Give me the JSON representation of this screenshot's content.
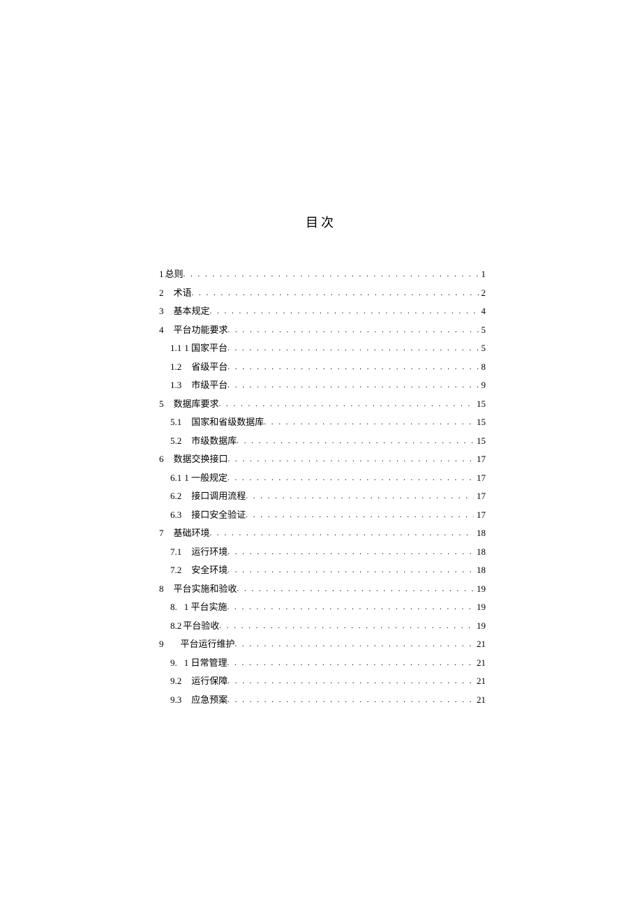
{
  "title": "目次",
  "entries": [
    {
      "num": "1",
      "gap1": 2,
      "label": "总则",
      "level": 1,
      "page": "1"
    },
    {
      "num": "2",
      "gap1": 14,
      "label": "术语",
      "level": 1,
      "page": "2"
    },
    {
      "num": "3",
      "gap1": 14,
      "label": "基本规定",
      "level": 1,
      "page": "4"
    },
    {
      "num": "4",
      "gap1": 14,
      "label": "平台功能要求",
      "level": 1,
      "page": "5"
    },
    {
      "num": "1.1",
      "gap1": 4,
      "label": "1 国家平台",
      "level": 2,
      "page": "5"
    },
    {
      "num": "1.2",
      "gap1": 14,
      "label": "省级平台",
      "level": 2,
      "page": "8"
    },
    {
      "num": "1.3",
      "gap1": 14,
      "label": "市级平台",
      "level": 2,
      "page": "9"
    },
    {
      "num": "5",
      "gap1": 14,
      "label": "数据库要求",
      "level": 1,
      "page": "15"
    },
    {
      "num": "5.1",
      "gap1": 14,
      "label": "国家和省级数据库",
      "level": 2,
      "page": "15"
    },
    {
      "num": "5.2",
      "gap1": 14,
      "label": "市级数据库",
      "level": 2,
      "page": "15"
    },
    {
      "num": "6",
      "gap1": 14,
      "label": "数据交换接口",
      "level": 1,
      "page": "17"
    },
    {
      "num": "6.1",
      "gap1": 4,
      "label": "1 一般规定",
      "level": 2,
      "page": "17"
    },
    {
      "num": "6.2",
      "gap1": 14,
      "label": "接口调用流程",
      "level": 2,
      "page": "17"
    },
    {
      "num": "6.3",
      "gap1": 14,
      "label": "接口安全验证",
      "level": 2,
      "page": "17"
    },
    {
      "num": "7",
      "gap1": 14,
      "label": "基础环境",
      "level": 1,
      "page": "18"
    },
    {
      "num": "7.1",
      "gap1": 14,
      "label": "运行环境",
      "level": 2,
      "page": "18"
    },
    {
      "num": "7.2",
      "gap1": 14,
      "label": "安全环境",
      "level": 2,
      "page": "18"
    },
    {
      "num": "8",
      "gap1": 14,
      "label": "平台实施和验收",
      "level": 1,
      "page": "19"
    },
    {
      "num": "8.",
      "gap1": 10,
      "label": "1 平台实施",
      "level": 2,
      "page": "19"
    },
    {
      "num": "8.2",
      "gap1": 2,
      "label": "平台验收",
      "level": 2,
      "page": "19"
    },
    {
      "num": "9",
      "gap1": 24,
      "label": "平台运行维护",
      "level": 1,
      "page": "21"
    },
    {
      "num": "9.",
      "gap1": 10,
      "label": "1 日常管理",
      "level": 2,
      "page": "21"
    },
    {
      "num": "9.2",
      "gap1": 14,
      "label": "运行保障",
      "level": 2,
      "page": "21"
    },
    {
      "num": "9.3",
      "gap1": 14,
      "label": "应急预案",
      "level": 2,
      "page": "21"
    }
  ]
}
